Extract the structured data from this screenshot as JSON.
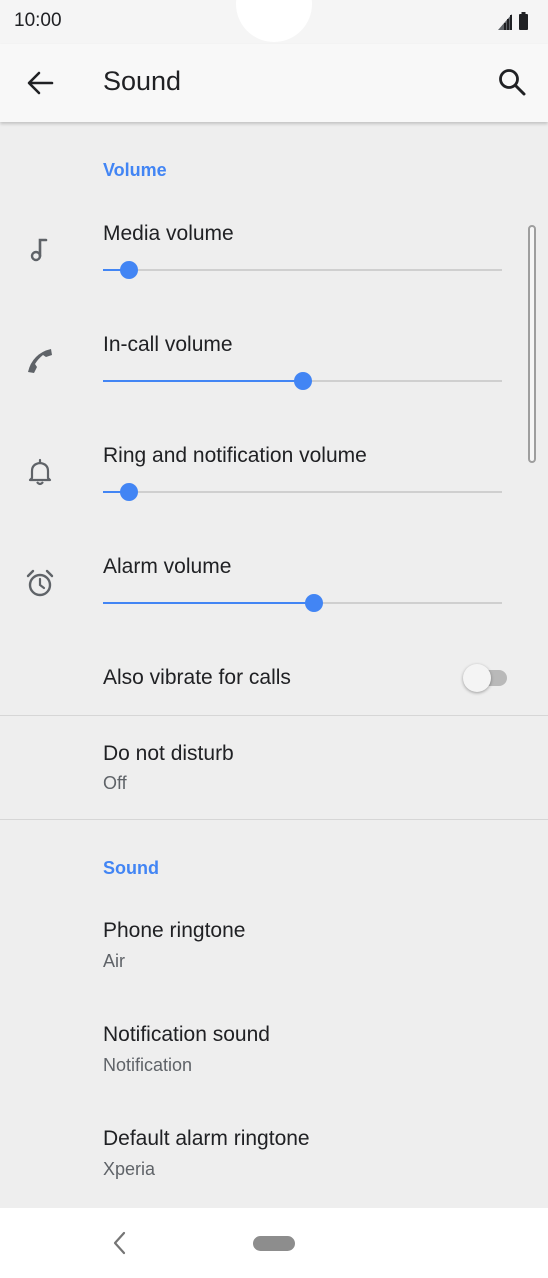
{
  "status_bar": {
    "time": "10:00"
  },
  "app_bar": {
    "title": "Sound"
  },
  "volume_section": {
    "header": "Volume",
    "sliders": [
      {
        "label": "Media volume",
        "icon": "music-note-icon",
        "level": 0.065
      },
      {
        "label": "In-call volume",
        "icon": "phone-icon",
        "level": 0.5
      },
      {
        "label": "Ring and notification volume",
        "icon": "bell-icon",
        "level": 0.065
      },
      {
        "label": "Alarm volume",
        "icon": "alarm-clock-icon",
        "level": 0.53
      }
    ]
  },
  "vibrate": {
    "label": "Also vibrate for calls",
    "enabled": false
  },
  "do_not_disturb": {
    "title": "Do not disturb",
    "value": "Off"
  },
  "sound_section": {
    "header": "Sound",
    "items": [
      {
        "title": "Phone ringtone",
        "value": "Air"
      },
      {
        "title": "Notification sound",
        "value": "Notification"
      },
      {
        "title": "Default alarm ringtone",
        "value": "Xperia"
      }
    ]
  },
  "colors": {
    "accent": "#4285f4",
    "background": "#eeeeee",
    "text": "#202124",
    "secondary_text": "#5f6368"
  }
}
